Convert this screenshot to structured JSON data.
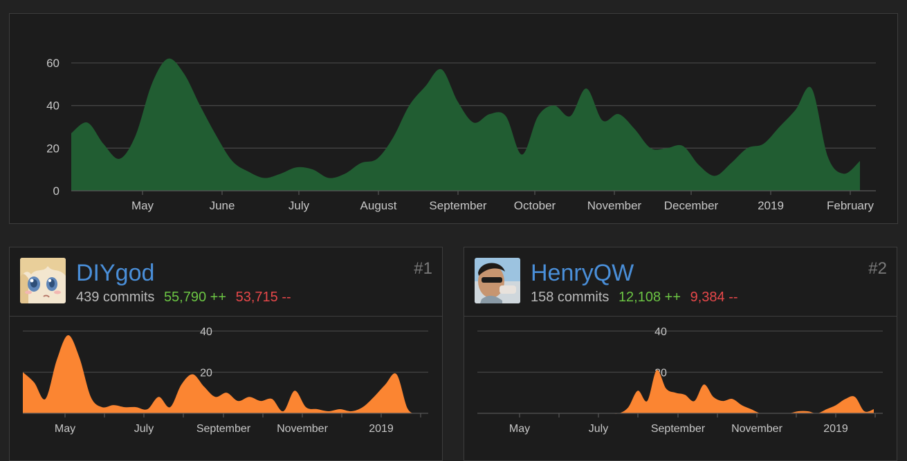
{
  "colors": {
    "background": "#222222",
    "panel": "#1c1c1c",
    "border": "#3d3d3d",
    "main_area": "#215d32",
    "contributor_area": "#fb8532",
    "username": "#4a8fd9",
    "additions": "#6cc644",
    "deletions": "#e8484a",
    "rank": "#7a7a7a"
  },
  "main_chart": {
    "chart_data": {
      "type": "area",
      "title": "",
      "xlabel": "",
      "ylabel": "",
      "ylim": [
        0,
        70
      ],
      "yticks": [
        "0",
        "20",
        "40",
        "60"
      ],
      "xticks": [
        "May",
        "June",
        "July",
        "August",
        "September",
        "October",
        "November",
        "December",
        "2019",
        "February"
      ],
      "grid": true,
      "x_weeks": [
        0,
        1,
        2,
        3,
        4,
        5,
        6,
        7,
        8,
        9,
        10,
        11,
        12,
        13,
        14,
        15,
        16,
        17,
        18,
        19,
        20,
        21,
        22,
        23,
        24,
        25,
        26,
        27,
        28,
        29,
        30,
        31,
        32,
        33,
        34,
        35,
        36,
        37,
        38,
        39,
        40,
        41,
        42,
        43
      ],
      "values": [
        27,
        32,
        22,
        15,
        26,
        50,
        62,
        55,
        40,
        26,
        14,
        9,
        6,
        8,
        11,
        10,
        6,
        8,
        13,
        15,
        25,
        40,
        49,
        57,
        42,
        32,
        36,
        35,
        17,
        35,
        40,
        35,
        48,
        33,
        36,
        29,
        20,
        20,
        21,
        12,
        7,
        13,
        20,
        22,
        30,
        38,
        48,
        16,
        8,
        14
      ]
    }
  },
  "contributors": [
    {
      "rank": "#1",
      "username": "DIYgod",
      "commits": "439 commits",
      "additions": "55,790 ++",
      "deletions": "53,715 --",
      "avatar_icon": "anime-avatar",
      "chart_data": {
        "type": "area",
        "title": "",
        "ylim": [
          0,
          45
        ],
        "yticks": [
          "20",
          "40"
        ],
        "xticks": [
          "May",
          "July",
          "September",
          "November",
          "2019"
        ],
        "grid": true,
        "values": [
          20,
          15,
          7,
          26,
          38,
          27,
          8,
          3,
          4,
          3,
          3,
          2,
          8,
          3,
          14,
          19,
          13,
          8,
          10,
          6,
          8,
          6,
          7,
          1,
          11,
          3,
          2,
          1,
          2,
          1,
          3,
          8,
          14,
          19,
          2,
          0
        ]
      }
    },
    {
      "rank": "#2",
      "username": "HenryQW",
      "commits": "158 commits",
      "additions": "12,108 ++",
      "deletions": "9,384 --",
      "avatar_icon": "person-photo-avatar",
      "chart_data": {
        "type": "area",
        "title": "",
        "ylim": [
          0,
          45
        ],
        "yticks": [
          "20",
          "40"
        ],
        "xticks": [
          "May",
          "July",
          "September",
          "November",
          "2019"
        ],
        "grid": true,
        "values": [
          0,
          0,
          0,
          0,
          0,
          0,
          0,
          0,
          0,
          0,
          0,
          0,
          0,
          0,
          0,
          0,
          3,
          11,
          6,
          21,
          12,
          10,
          9,
          6,
          14,
          8,
          6,
          7,
          4,
          2,
          0,
          0,
          0,
          0,
          1,
          1,
          0,
          2,
          4,
          7,
          8,
          1,
          2
        ]
      }
    }
  ]
}
